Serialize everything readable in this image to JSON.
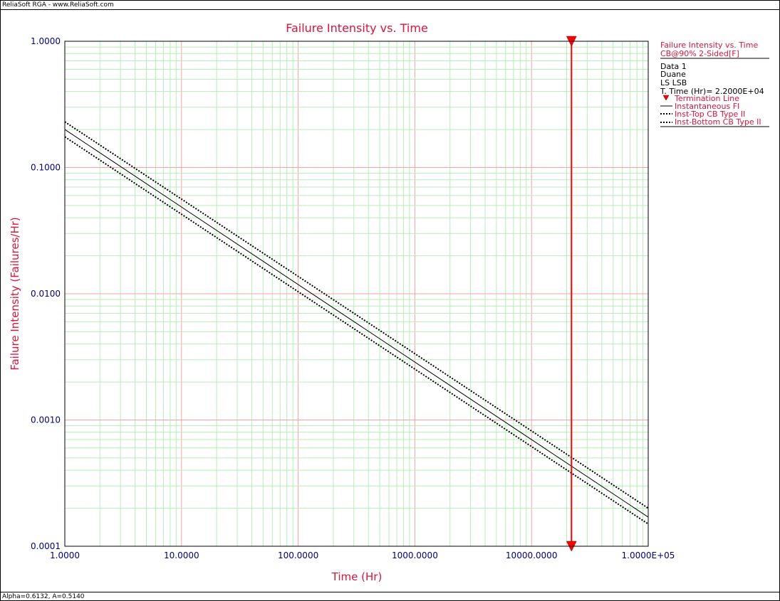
{
  "header": {
    "app_title": "ReliaSoft RGA - www.ReliaSoft.com"
  },
  "footer": {
    "status": "Alpha=0.6132, A=0.5140"
  },
  "legend": {
    "title": "Failure Intensity vs. Time",
    "subtitle": "CB@90% 2-Sided[F]",
    "info": [
      "Data 1",
      "Duane",
      "LS LSB",
      "T. Time (Hr)= 2.2000E+04"
    ],
    "entries": [
      {
        "label": "Termination Line",
        "style": "marker"
      },
      {
        "label": "Instantaneous FI",
        "style": "solid"
      },
      {
        "label": "Inst-Top CB Type II",
        "style": "dotted"
      },
      {
        "label": "Inst-Bottom CB Type II",
        "style": "dotted"
      }
    ]
  },
  "colors": {
    "accent": "#dc143c",
    "axis_text": "#000080",
    "major_grid": "#f4a3a3",
    "minor_grid": "#b8ecb8",
    "termination": "#ff0000",
    "curve": "#000000"
  },
  "chart_data": {
    "type": "line",
    "title": "Failure Intensity vs. Time",
    "xlabel": "Time (Hr)",
    "ylabel": "Failure Intensity (Failures/Hr)",
    "xscale": "log",
    "yscale": "log",
    "xlim": [
      1,
      100000
    ],
    "ylim": [
      0.0001,
      1
    ],
    "grid": true,
    "legend_position": "right",
    "xticks": [
      {
        "value": 1,
        "label": "1.0000"
      },
      {
        "value": 10,
        "label": "10.0000"
      },
      {
        "value": 100,
        "label": "100.0000"
      },
      {
        "value": 1000,
        "label": "1000.0000"
      },
      {
        "value": 10000,
        "label": "10000.0000"
      },
      {
        "value": 100000,
        "label": "1.0000E+05"
      }
    ],
    "yticks": [
      {
        "value": 1,
        "label": "1.0000"
      },
      {
        "value": 0.1,
        "label": "0.1000"
      },
      {
        "value": 0.01,
        "label": "0.0100"
      },
      {
        "value": 0.001,
        "label": "0.0010"
      },
      {
        "value": 0.0001,
        "label": "0.0001"
      }
    ],
    "termination_time": 22000,
    "series": [
      {
        "name": "Instantaneous FI",
        "style": "solid",
        "x": [
          1,
          100000
        ],
        "y": [
          0.2,
          0.00017
        ]
      },
      {
        "name": "Inst-Top CB Type II",
        "style": "dotted",
        "x": [
          1,
          100000
        ],
        "y": [
          0.23,
          0.0002
        ]
      },
      {
        "name": "Inst-Bottom CB Type II",
        "style": "dotted",
        "x": [
          1,
          100000
        ],
        "y": [
          0.175,
          0.00015
        ]
      }
    ]
  }
}
